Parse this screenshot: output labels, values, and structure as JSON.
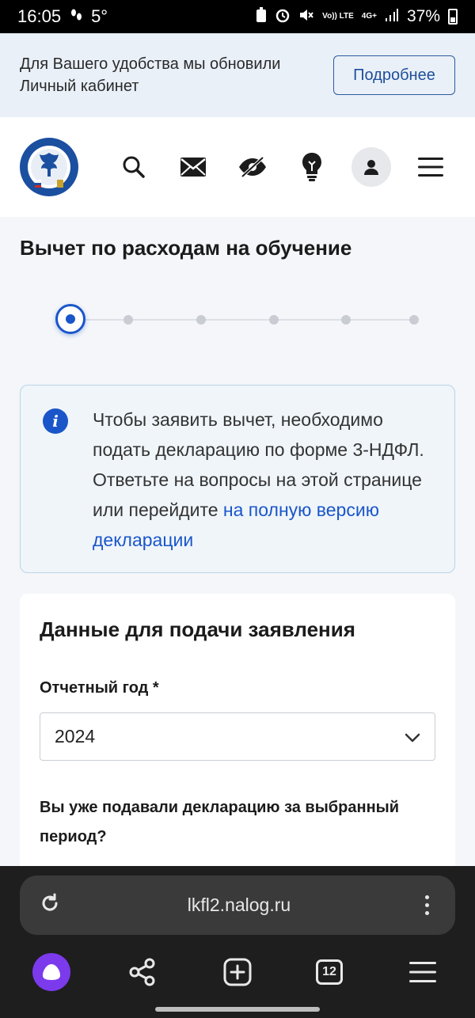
{
  "status_bar": {
    "time": "16:05",
    "temperature": "5°",
    "network_top": "Vo)) LTE",
    "network_type": "4G+",
    "battery": "37%"
  },
  "notice": {
    "text": "Для Вашего удобства мы обновили Личный кабинет",
    "button": "Подробнее"
  },
  "header": {
    "icons": [
      "emblem-logo",
      "search-icon",
      "mail-icon",
      "visually-impaired-icon",
      "lightbulb-icon",
      "user-icon",
      "menu-icon"
    ]
  },
  "page": {
    "title": "Вычет по расходам на обучение",
    "stepper": {
      "total_steps": 6,
      "current_step": 1
    }
  },
  "info": {
    "text": "Чтобы заявить вычет, необходимо подать декларацию по форме 3-НДФЛ. Ответьте на вопросы на этой странице или перейдите ",
    "link": "на полную версию декларации"
  },
  "form": {
    "title": "Данные для подачи заявления",
    "year_label": "Отчетный год *",
    "year_value": "2024",
    "question": "Вы уже подавали декларацию за выбранный период?"
  },
  "browser": {
    "url": "lkfl2.nalog.ru",
    "tabs_count": "12"
  },
  "colors": {
    "accent": "#1a56c9",
    "notice_bg": "#e9f0f8",
    "browser_bg": "#1e1e1e",
    "alice": "#7c3aed"
  }
}
